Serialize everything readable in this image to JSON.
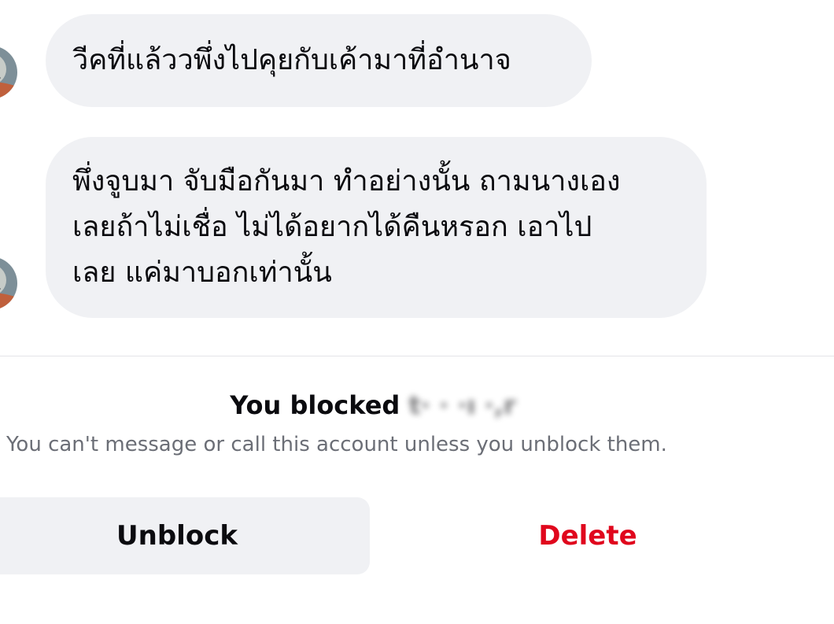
{
  "messages": [
    {
      "text": "วีคที่แล้ววพึ่งไปคุยกับเค้ามาที่อำนาจ"
    },
    {
      "lines": [
        "พึ่งจูบมา จับมือกันมา ทำอย่างนั้น ถามนางเอง",
        "เลยถ้าไม่เชื่อ ไม่ได้อยากได้คืนหรอก เอาไป",
        "เลย แค่มาบอกเท่านั้น"
      ]
    }
  ],
  "blocked": {
    "title_prefix": "You blocked",
    "name_redacted": "t· ·  ·ı ·,r",
    "subtitle": "You can't message or call this account unless you unblock them."
  },
  "actions": {
    "unblock_label": "Unblock",
    "delete_label": "Delete"
  },
  "colors": {
    "bubble": "#f0f1f4",
    "delete": "#e0071d",
    "subtitle": "#6b6e76"
  },
  "icons": {
    "avatar": "contact-avatar"
  }
}
